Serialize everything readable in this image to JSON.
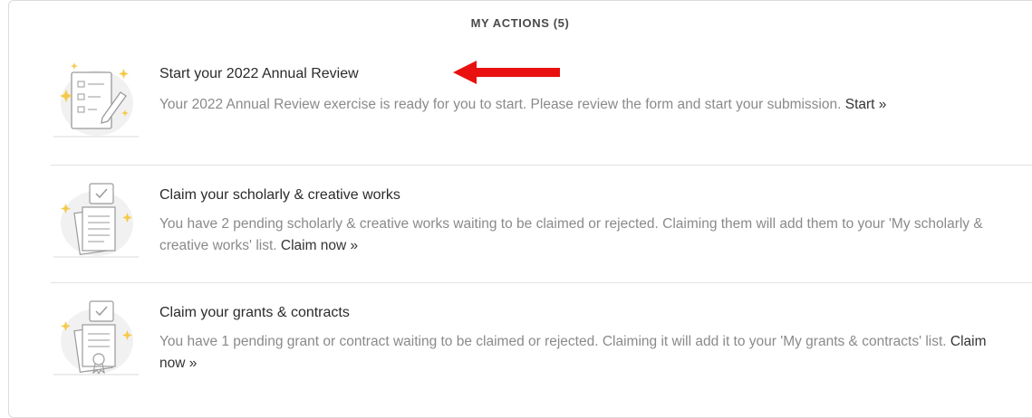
{
  "header": {
    "title": "MY ACTIONS (5)"
  },
  "actions": [
    {
      "icon": "annual-review-form-icon",
      "title": "Start your 2022 Annual Review",
      "description": "Your 2022 Annual Review exercise is ready for you to start. Please review the form and start your submission.",
      "link_label": "Start »"
    },
    {
      "icon": "scholarly-works-document-icon",
      "title": "Claim your scholarly & creative works",
      "description": "You have 2 pending scholarly & creative works waiting to be claimed or rejected. Claiming them will add them to your 'My scholarly & creative works' list.",
      "link_label": "Claim now »"
    },
    {
      "icon": "grants-certificate-icon",
      "title": "Claim your grants & contracts",
      "description": "You have 1 pending grant or contract waiting to be claimed or rejected. Claiming it will add it to your 'My grants & contracts' list.",
      "link_label": "Claim now »"
    }
  ],
  "annotation": {
    "icon": "red-arrow-icon",
    "color": "#e8110f"
  },
  "colors": {
    "title": "#2b2b2b",
    "description": "#8a8a8a",
    "link": "#333333",
    "divider": "#e2e2e2",
    "border": "#dcdcdc"
  }
}
